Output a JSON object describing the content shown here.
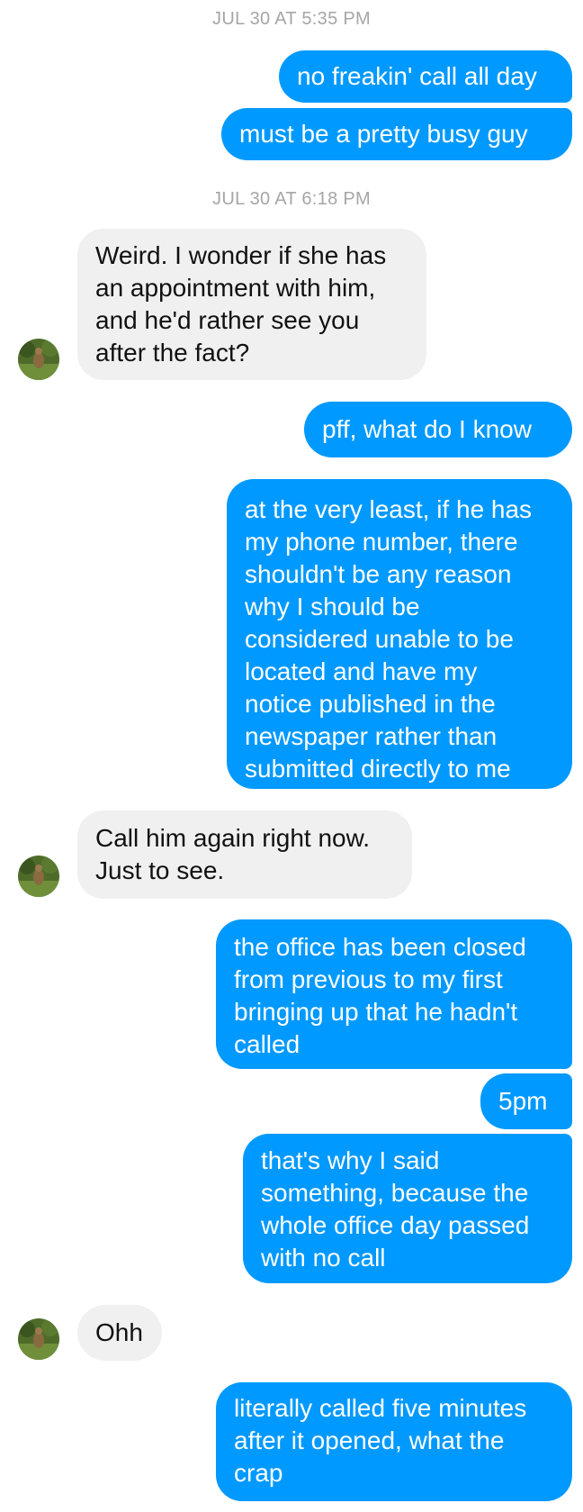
{
  "colors": {
    "outgoing_bubble": "#0099ff",
    "incoming_bubble": "#f0f0f0",
    "timestamp": "#a6a6a6"
  },
  "timestamps": [
    "JUL 30 AT 5:35 PM",
    "JUL 30 AT 6:18 PM"
  ],
  "messages": [
    {
      "from": "me",
      "text": "no freakin' call all day"
    },
    {
      "from": "me",
      "text": "must be a pretty busy guy"
    },
    {
      "from": "them",
      "text": "Weird. I wonder if she has\nan appointment with him,\nand he'd rather see you\nafter the fact?"
    },
    {
      "from": "me",
      "text": "pff, what do I know"
    },
    {
      "from": "me",
      "text": "at the very least, if he has\nmy phone number, there\nshouldn't be any reason\nwhy I should be\nconsidered unable to be\nlocated and have my\nnotice published in the\nnewspaper rather than\nsubmitted directly to me"
    },
    {
      "from": "them",
      "text": "Call him again right now.\nJust to see."
    },
    {
      "from": "me",
      "text": "the office has been closed\nfrom previous to my first\nbringing up that he hadn't\ncalled"
    },
    {
      "from": "me",
      "text": "5pm"
    },
    {
      "from": "me",
      "text": "that's why I said\nsomething, because the\nwhole office day passed\nwith no call"
    },
    {
      "from": "them",
      "text": "Ohh"
    },
    {
      "from": "me",
      "text": "literally called five minutes\nafter it opened, what the\ncrap"
    }
  ],
  "contact": {
    "avatar_icon": "contact-avatar-photo"
  }
}
